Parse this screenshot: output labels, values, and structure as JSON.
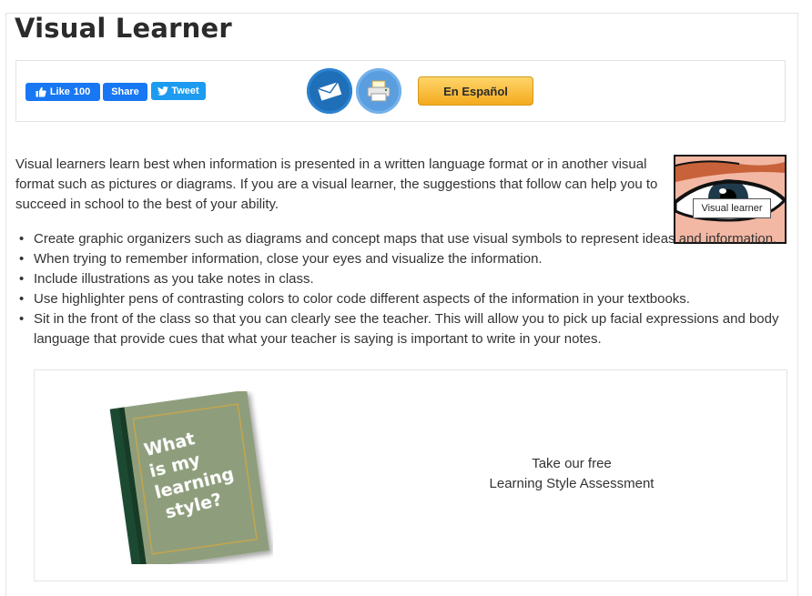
{
  "page": {
    "title": "Visual Learner"
  },
  "share_bar": {
    "like_label": "Like",
    "like_count": "100",
    "share_label": "Share",
    "tweet_label": "Tweet",
    "espanol_label": "En Español",
    "icons": [
      "thumbs-up-icon",
      "twitter-bird-icon",
      "email-icon",
      "print-icon"
    ]
  },
  "intro_text": "Visual learners learn best when information is presented in a written language format or in another visual format such as pictures or diagrams. If you are a visual learner, the suggestions that follow can help you to succeed in school to the best of your ability.",
  "image": {
    "tooltip": "Visual learner"
  },
  "tips": [
    "Create graphic organizers such as diagrams and concept maps that use visual symbols to represent ideas and information.",
    "When trying to remember information, close your eyes and visualize the information.",
    "Include illustrations as you take notes in class.",
    "Use highlighter pens of contrasting colors to color code different aspects of the information in your textbooks.",
    "Sit in the front of the class so that you can clearly see the teacher. This will allow you to pick up facial expressions and body language that provide cues that what your teacher is saying is important to write in your notes."
  ],
  "promo": {
    "book_lines": [
      "What",
      "is my",
      "learning",
      "style?"
    ],
    "cta_line1": "Take our free",
    "cta_line2": "Learning Style Assessment"
  },
  "colors": {
    "facebook": "#1877f2",
    "twitter": "#1d9bf0",
    "email": "#1f6fb8",
    "print": "#5a9ee0",
    "espanol": "#f4aa1d"
  }
}
